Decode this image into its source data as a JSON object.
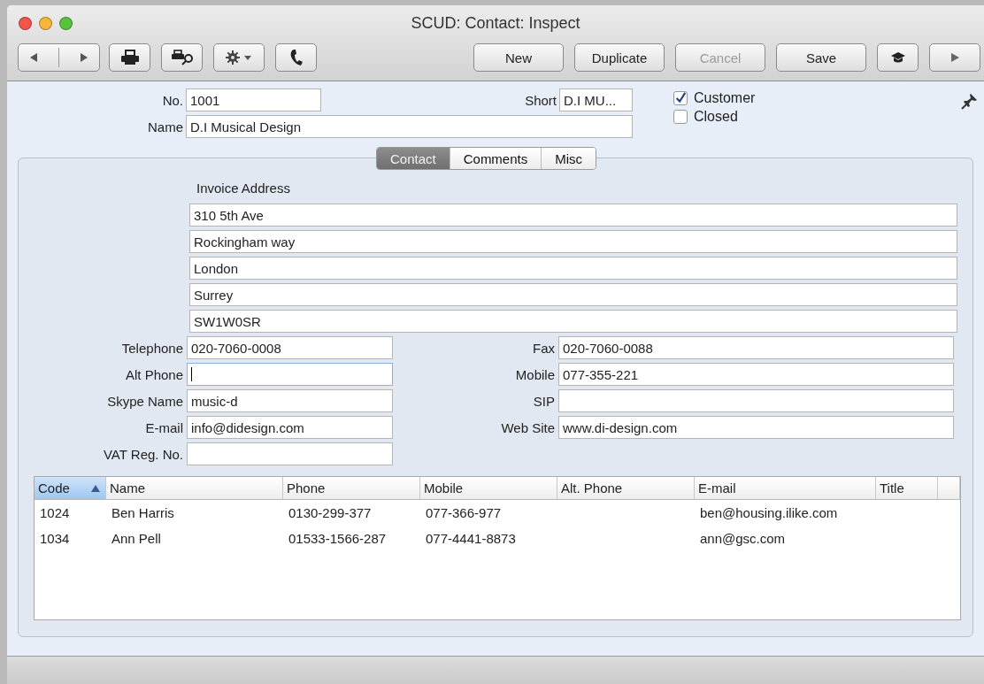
{
  "window": {
    "title": "SCUD: Contact: Inspect"
  },
  "toolbar": {
    "buttons": [
      {
        "label": "New",
        "disabled": false
      },
      {
        "label": "Duplicate",
        "disabled": false
      },
      {
        "label": "Cancel",
        "disabled": true
      },
      {
        "label": "Save",
        "disabled": false
      }
    ]
  },
  "header": {
    "number": {
      "label": "No.",
      "value": "1001"
    },
    "short": {
      "label": "Short",
      "value": "D.I MU..."
    },
    "name": {
      "label": "Name",
      "value": "D.I Musical Design"
    },
    "checkboxes": [
      {
        "label": "Customer",
        "checked": true
      },
      {
        "label": "Closed",
        "checked": false
      }
    ]
  },
  "tabs": [
    {
      "label": "Contact",
      "selected": true
    },
    {
      "label": "Comments",
      "selected": false
    },
    {
      "label": "Misc",
      "selected": false
    }
  ],
  "contact": {
    "section_label": "Invoice Address",
    "address_lines": [
      "310 5th Ave",
      "Rockingham way",
      "London",
      "Surrey",
      "SW1W0SR"
    ],
    "left_fields": [
      {
        "label": "Telephone",
        "value": "020-7060-0008",
        "focused": false
      },
      {
        "label": "Alt Phone",
        "focused": true
      },
      {
        "label": "Skype Name",
        "value": "music-d",
        "focused": false
      },
      {
        "label": "E-mail",
        "value": "info@didesign.com",
        "focused": false
      },
      {
        "label": "VAT Reg. No.",
        "focused": false
      }
    ],
    "right_fields": [
      {
        "label": "Fax",
        "value": "020-7060-0088",
        "focused": false
      },
      {
        "label": "Mobile",
        "value": "077-355-221",
        "focused": false
      },
      {
        "label": "SIP",
        "focused": false
      },
      {
        "label": "Web Site",
        "value": "www.di-design.com",
        "focused": false
      }
    ]
  },
  "table": {
    "columns": [
      {
        "label": "Code",
        "sorted": true
      },
      {
        "label": "Name",
        "sorted": false
      },
      {
        "label": "Phone",
        "sorted": false
      },
      {
        "label": "Mobile",
        "sorted": false
      },
      {
        "label": "Alt. Phone",
        "sorted": false
      },
      {
        "label": "E-mail",
        "sorted": false
      },
      {
        "label": "Title",
        "sorted": false
      }
    ],
    "rows": [
      {
        "cells": [
          "1024",
          "Ben Harris",
          "0130-299-377",
          "077-366-977",
          null,
          "ben@housing.ilike.com",
          null
        ]
      },
      {
        "cells": [
          "1034",
          "Ann Pell",
          "01533-1566-287",
          "077-4441-8873",
          null,
          "ann@gsc.com",
          null
        ]
      }
    ]
  }
}
